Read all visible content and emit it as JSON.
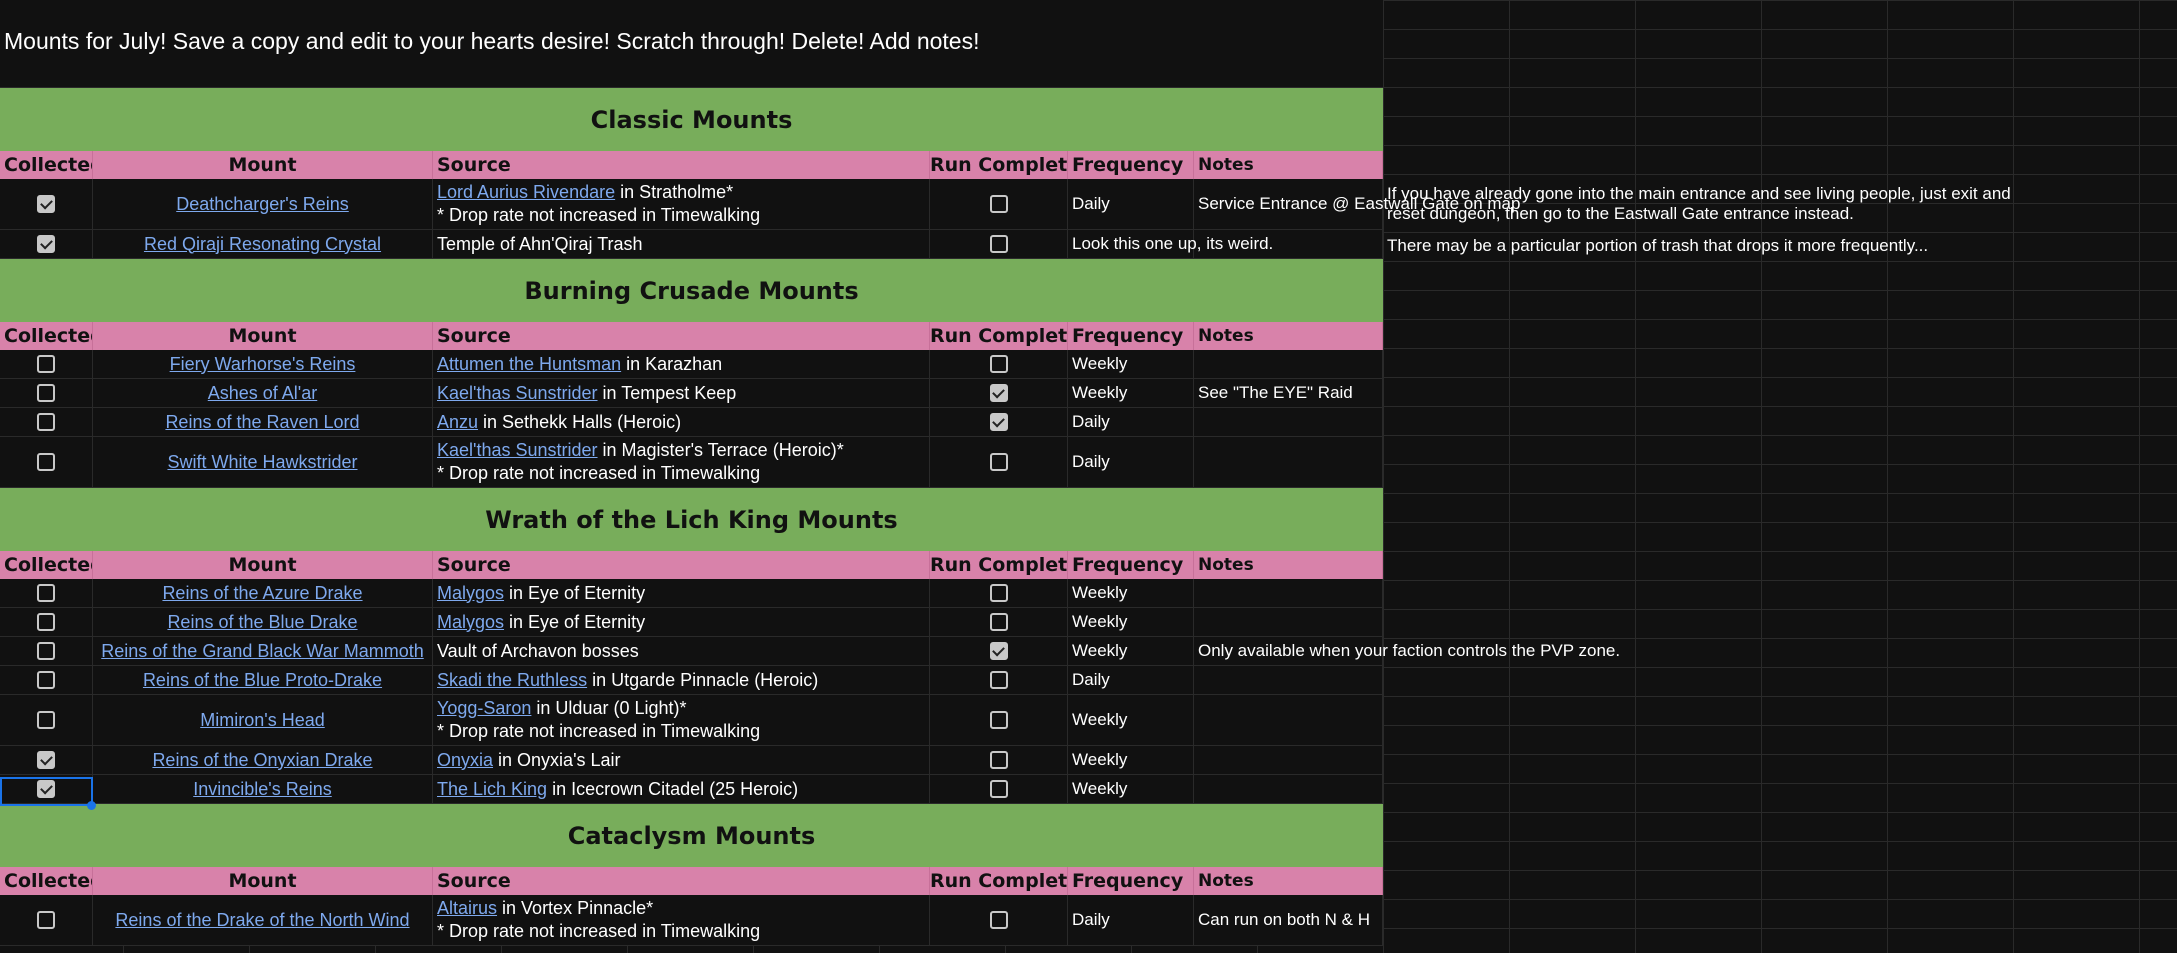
{
  "title": "Mounts for July! Save a copy and edit to your hearts desire! Scratch through! Delete! Add notes!",
  "columns": {
    "collected": "Collected",
    "mount": "Mount",
    "source": "Source",
    "run_complete": "Run Complete",
    "frequency": "Frequency",
    "notes": "Notes"
  },
  "sections": [
    {
      "title": "Classic Mounts",
      "rows": [
        {
          "collected": true,
          "mount": "Deathcharger's Reins",
          "source_link": "Lord Aurius Rivendare",
          "source_text": " in Stratholme*",
          "source_line2": "* Drop rate not increased in Timewalking",
          "run_complete": false,
          "frequency": "Daily",
          "notes": "Service Entrance @ Eastwall Gate on map",
          "ext_note": "If you have already gone into the main entrance and see living people, just exit and reset dungeon, then go to the Eastwall Gate entrance instead."
        },
        {
          "collected": true,
          "mount": "Red Qiraji Resonating Crystal",
          "source_link": "",
          "source_text": "Temple of Ahn'Qiraj Trash",
          "source_line2": "",
          "run_complete": false,
          "frequency": "Look this one up, its weird.",
          "notes": "",
          "ext_note": "There may be a particular portion of trash that drops it more frequently..."
        }
      ]
    },
    {
      "title": "Burning Crusade Mounts",
      "rows": [
        {
          "collected": false,
          "mount": "Fiery Warhorse's Reins",
          "source_link": "Attumen the Huntsman",
          "source_text": " in Karazhan",
          "source_line2": "",
          "run_complete": false,
          "frequency": "Weekly",
          "notes": ""
        },
        {
          "collected": false,
          "mount": "Ashes of Al'ar",
          "source_link": "Kael'thas Sunstrider",
          "source_text": " in Tempest Keep",
          "source_line2": "",
          "run_complete": true,
          "frequency": "Weekly",
          "notes": "See \"The EYE\" Raid"
        },
        {
          "collected": false,
          "mount": "Reins of the Raven Lord",
          "source_link": "Anzu",
          "source_text": " in Sethekk Halls (Heroic)",
          "source_line2": "",
          "run_complete": true,
          "frequency": "Daily",
          "notes": ""
        },
        {
          "collected": false,
          "mount": "Swift White Hawkstrider",
          "source_link": "Kael'thas Sunstrider",
          "source_text": " in Magister's Terrace (Heroic)*",
          "source_line2": "* Drop rate not increased in Timewalking",
          "run_complete": false,
          "frequency": "Daily",
          "notes": ""
        }
      ]
    },
    {
      "title": "Wrath of the Lich King Mounts",
      "rows": [
        {
          "collected": false,
          "mount": "Reins of the Azure Drake",
          "source_link": "Malygos",
          "source_text": " in Eye of Eternity",
          "source_line2": "",
          "run_complete": false,
          "frequency": "Weekly",
          "notes": ""
        },
        {
          "collected": false,
          "mount": "Reins of the Blue Drake",
          "source_link": "Malygos",
          "source_text": " in Eye of Eternity",
          "source_line2": "",
          "run_complete": false,
          "frequency": "Weekly",
          "notes": ""
        },
        {
          "collected": false,
          "mount": "Reins of the Grand Black War Mammoth",
          "source_link": "",
          "source_text": "Vault of Archavon bosses",
          "source_line2": "",
          "run_complete": true,
          "frequency": "Weekly",
          "notes": "Only available when your faction controls the PVP zone."
        },
        {
          "collected": false,
          "mount": "Reins of the Blue Proto-Drake",
          "source_link": "Skadi the Ruthless",
          "source_text": " in Utgarde Pinnacle (Heroic)",
          "source_line2": "",
          "run_complete": false,
          "frequency": "Daily",
          "notes": ""
        },
        {
          "collected": false,
          "mount": "Mimiron's Head",
          "source_link": "Yogg-Saron",
          "source_text": " in Ulduar (0 Light)*",
          "source_line2": "* Drop rate not increased in Timewalking",
          "run_complete": false,
          "frequency": "Weekly",
          "notes": ""
        },
        {
          "collected": true,
          "mount": "Reins of the Onyxian Drake",
          "source_link": "Onyxia",
          "source_text": " in Onyxia's Lair",
          "source_line2": "",
          "run_complete": false,
          "frequency": "Weekly",
          "notes": ""
        },
        {
          "collected": true,
          "mount": "Invincible's Reins",
          "source_link": "The Lich King",
          "source_text": " in Icecrown Citadel (25 Heroic)",
          "source_line2": "",
          "run_complete": false,
          "frequency": "Weekly",
          "notes": ""
        }
      ]
    },
    {
      "title": "Cataclysm Mounts",
      "rows": [
        {
          "collected": false,
          "mount": "Reins of the Drake of the North Wind",
          "source_link": "Altairus",
          "source_text": " in Vortex Pinnacle*",
          "source_line2": "* Drop rate not increased in Timewalking",
          "run_complete": false,
          "frequency": "Daily",
          "notes": "Can run on both N & H"
        }
      ]
    }
  ],
  "colors": {
    "section_bg": "#78ad5b",
    "header_bg": "#d882aa",
    "link": "#7ea9ee",
    "selection": "#1a73e8"
  }
}
